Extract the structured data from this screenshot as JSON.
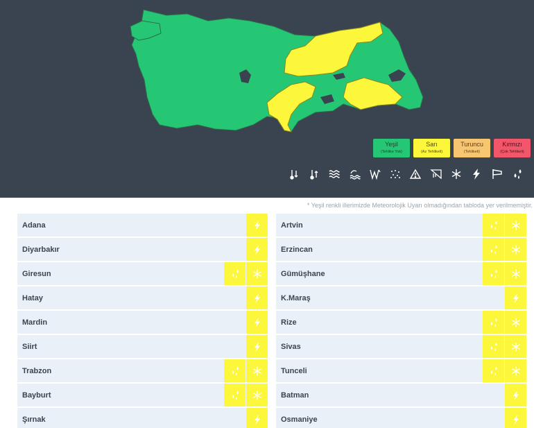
{
  "legend": [
    {
      "label": "Yeşil",
      "sub": "(Tehlike Yok)",
      "color": "#26c774"
    },
    {
      "label": "Sarı",
      "sub": "(Az Tehlikeli)",
      "color": "#fcf73a"
    },
    {
      "label": "Turuncu",
      "sub": "(Tehlikeli)",
      "color": "#f8c571"
    },
    {
      "label": "Kırmızı",
      "sub": "(Çok Tehlikeli)",
      "color": "#f2566a"
    }
  ],
  "hazards": [
    "low-temp-icon",
    "high-temp-icon",
    "fog-icon",
    "sea-wave-icon",
    "wind-icon",
    "dust-icon",
    "avalanche-icon",
    "icing-icon",
    "snow-icon",
    "thunderstorm-icon",
    "storm-wind-icon",
    "rain-icon"
  ],
  "note": "* Yeşil renkli illerimizde Meteorolojik Uyarı olmadığından tabloda yer verilmemiştir.",
  "colors": {
    "map_bg": "#3a4450",
    "green": "#26c774",
    "yellow": "#fcf73a",
    "row_bg": "#e9f0f7"
  },
  "left_column": [
    {
      "name": "Adana",
      "icons": [
        "thunderstorm-icon"
      ]
    },
    {
      "name": "Diyarbakır",
      "icons": [
        "thunderstorm-icon"
      ]
    },
    {
      "name": "Giresun",
      "icons": [
        "rain-icon",
        "snow-icon"
      ]
    },
    {
      "name": "Hatay",
      "icons": [
        "thunderstorm-icon"
      ]
    },
    {
      "name": "Mardin",
      "icons": [
        "thunderstorm-icon"
      ]
    },
    {
      "name": "Siirt",
      "icons": [
        "thunderstorm-icon"
      ]
    },
    {
      "name": "Trabzon",
      "icons": [
        "rain-icon",
        "snow-icon"
      ]
    },
    {
      "name": "Bayburt",
      "icons": [
        "rain-icon",
        "snow-icon"
      ]
    },
    {
      "name": "Şırnak",
      "icons": [
        "thunderstorm-icon"
      ]
    }
  ],
  "right_column": [
    {
      "name": "Artvin",
      "icons": [
        "rain-icon",
        "snow-icon"
      ]
    },
    {
      "name": "Erzincan",
      "icons": [
        "rain-icon",
        "snow-icon"
      ]
    },
    {
      "name": "Gümüşhane",
      "icons": [
        "rain-icon",
        "snow-icon"
      ]
    },
    {
      "name": "K.Maraş",
      "icons": [
        "thunderstorm-icon"
      ]
    },
    {
      "name": "Rize",
      "icons": [
        "rain-icon",
        "snow-icon"
      ]
    },
    {
      "name": "Sivas",
      "icons": [
        "rain-icon",
        "snow-icon"
      ]
    },
    {
      "name": "Tunceli",
      "icons": [
        "rain-icon",
        "snow-icon"
      ]
    },
    {
      "name": "Batman",
      "icons": [
        "thunderstorm-icon"
      ]
    },
    {
      "name": "Osmaniye",
      "icons": [
        "thunderstorm-icon"
      ]
    }
  ]
}
